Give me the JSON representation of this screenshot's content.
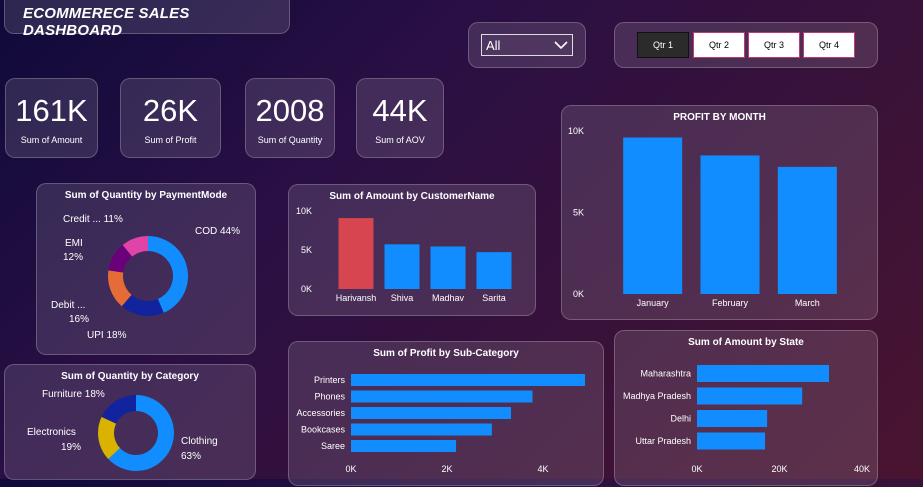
{
  "header": {
    "title": "ECOMMERECE SALES DASHBOARD"
  },
  "filter": {
    "selected": "All"
  },
  "quarters": {
    "buttons": [
      "Qtr 1",
      "Qtr 2",
      "Qtr 3",
      "Qtr 4"
    ],
    "active": "Qtr 1"
  },
  "kpis": [
    {
      "value": "161K",
      "label": "Sum of Amount"
    },
    {
      "value": "26K",
      "label": "Sum of Profit"
    },
    {
      "value": "2008",
      "label": "Sum of Quantity"
    },
    {
      "value": "44K",
      "label": "Sum of AOV"
    }
  ],
  "colors": {
    "blue": "#118dff",
    "red": "#d64550",
    "navy": "#12239e",
    "orange": "#e66c37",
    "purple": "#6b007b",
    "pink": "#e044a7",
    "yellow": "#d9b300"
  },
  "chart_data": [
    {
      "type": "pie",
      "title": "Sum of Quantity by PaymentMode",
      "categories": [
        "COD",
        "UPI",
        "Debit ...",
        "EMI",
        "Credit ..."
      ],
      "values": [
        44,
        18,
        16,
        12,
        11
      ],
      "labels": [
        "COD 44%",
        "UPI 18%",
        "Debit ...",
        "16%",
        "EMI",
        "12%",
        "Credit ... 11%"
      ]
    },
    {
      "type": "bar",
      "title": "Sum of Amount by CustomerName",
      "categories": [
        "Harivansh",
        "Shiva",
        "Madhav",
        "Sarita"
      ],
      "values": [
        10000,
        6300,
        6000,
        5200
      ],
      "ylim": [
        0,
        11000
      ],
      "yticks": [
        "10K",
        "5K",
        "0K"
      ]
    },
    {
      "type": "bar",
      "title": "PROFIT BY MONTH",
      "categories": [
        "January",
        "February",
        "March"
      ],
      "values": [
        9600,
        8500,
        7800
      ],
      "ylim": [
        0,
        10000
      ],
      "yticks": [
        "10K",
        "5K",
        "0K"
      ]
    },
    {
      "type": "pie",
      "title": "Sum of Quantity by Category",
      "categories": [
        "Clothing",
        "Electronics",
        "Furniture"
      ],
      "values": [
        63,
        19,
        18
      ],
      "labels": [
        "Clothing",
        "63%",
        "Electronics",
        "19%",
        "Furniture 18%"
      ]
    },
    {
      "type": "bar",
      "orientation": "horizontal",
      "title": "Sum of Profit by Sub-Category",
      "categories": [
        "Printers",
        "Phones",
        "Accessories",
        "Bookcases",
        "Saree"
      ],
      "values": [
        4900,
        3800,
        3350,
        2950,
        2200
      ],
      "xlim": [
        0,
        4900
      ],
      "xticks": [
        "0K",
        "2K",
        "4K"
      ]
    },
    {
      "type": "bar",
      "orientation": "horizontal",
      "title": "Sum of Amount by State",
      "categories": [
        "Maharashtra",
        "Madhya Pradesh",
        "Delhi",
        "Uttar Pradesh"
      ],
      "values": [
        32000,
        25500,
        17000,
        16500
      ],
      "xlim": [
        0,
        40000
      ],
      "xticks": [
        "0K",
        "20K",
        "40K"
      ]
    }
  ]
}
